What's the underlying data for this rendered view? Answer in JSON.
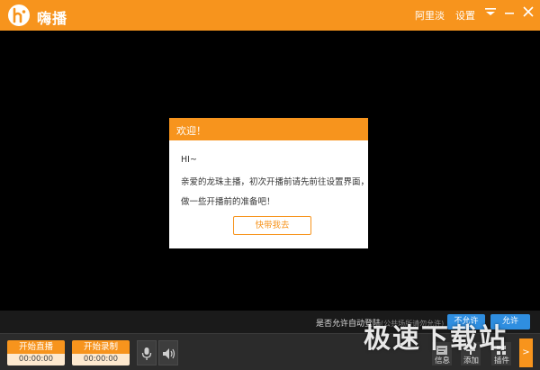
{
  "titlebar": {
    "app_name": "嗨播",
    "user": "阿里淡",
    "settings": "设置"
  },
  "dialog": {
    "title": "欢迎！",
    "lines": [
      "HI~",
      "亲爱的龙珠主播，初次开播前请先前往设置界面，",
      "做一些开播前的准备吧！"
    ],
    "button": "快带我去"
  },
  "notify": {
    "text": "是否允许自动登陆",
    "sub": "(公共场所请勿允许)",
    "deny": "不允许",
    "allow": "允许"
  },
  "controls": {
    "live": {
      "label": "开始直播",
      "time": "00:00:00"
    },
    "record": {
      "label": "开始录制",
      "time": "00:00:00"
    }
  },
  "tools": {
    "info": "信息",
    "add": "添加",
    "plugin": "插件",
    "more": ">"
  },
  "watermark": "极速下载站",
  "colors": {
    "accent": "#f7941d",
    "button_blue": "#2f8ee0",
    "background": "#000000"
  }
}
